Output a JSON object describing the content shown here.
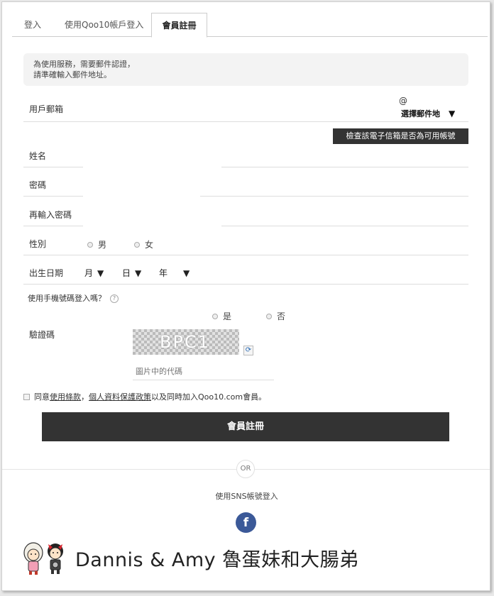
{
  "tabs": [
    {
      "label": "登入"
    },
    {
      "label": "使用Qoo10帳戶登入"
    },
    {
      "label": "會員註冊"
    }
  ],
  "notice": {
    "line1": "為使用服務，需要郵件認證，",
    "line2": "請準確輸入郵件地址。"
  },
  "form": {
    "email_label": "用戶郵箱",
    "email_at": "@",
    "email_domain_select": "選擇郵件地",
    "check_email_button": "檢查該電子信箱是否為可用帳號",
    "name_label": "姓名",
    "password_label": "密碼",
    "password_confirm_label": "再輸入密碼",
    "gender_label": "性別",
    "gender_male": "男",
    "gender_female": "女",
    "dob_label": "出生日期",
    "dob_month": "月",
    "dob_day": "日",
    "dob_year": "年",
    "mobile_login_question": "使用手機號碼登入嗎？",
    "mobile_yes": "是",
    "mobile_no": "否",
    "captcha_label": "驗證碼",
    "captcha_text": "BPC1",
    "captcha_placeholder": "圖片中的代碼"
  },
  "agreement": {
    "prefix": "同意",
    "terms_link": "使用條款",
    "comma": "，",
    "privacy_link": "個人資料保護政策",
    "suffix": "以及同時加入Qoo10.com會員。"
  },
  "submit_label": "會員註冊",
  "or_label": "OR",
  "sns_label": "使用SNS帳號登入",
  "facebook_letter": "f",
  "watermark": "Dannis & Amy 魯蛋妹和大腸弟",
  "colors": {
    "dark_button": "#333333",
    "facebook": "#3b5998",
    "notice_bg": "#f3f3f3"
  },
  "arrow_glyph": "▼",
  "question_glyph": "?",
  "refresh_glyph": "⟳"
}
